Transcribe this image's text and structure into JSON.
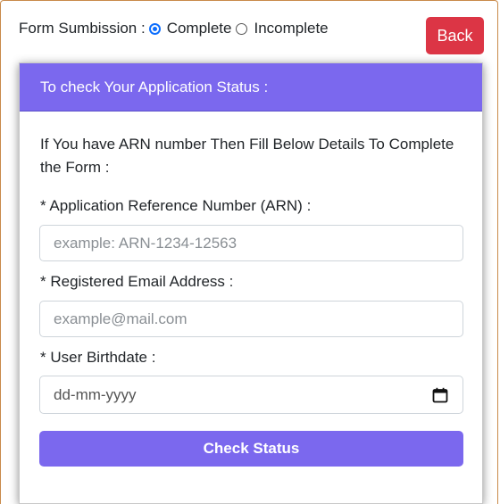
{
  "form_submission": {
    "label": "Form Sumbission :",
    "options": [
      {
        "label": "Complete",
        "checked": true
      },
      {
        "label": "Incomplete",
        "checked": false
      }
    ]
  },
  "back_button": {
    "label": "Back"
  },
  "card": {
    "header": "To check Your Application Status :",
    "intro": "If You have ARN number Then Fill Below Details To Complete the Form :",
    "fields": {
      "arn": {
        "label": "* Application Reference Number (ARN) :",
        "placeholder": "example: ARN-1234-12563"
      },
      "email": {
        "label": "* Registered Email Address :",
        "placeholder": "example@mail.com"
      },
      "birthdate": {
        "label": "* User Birthdate :",
        "placeholder": "dd-mm-yyyy",
        "icon": "calendar-icon"
      }
    },
    "submit_label": "Check Status"
  },
  "colors": {
    "accent": "#7b68ee",
    "danger": "#dc3545",
    "radio_checked": "#0d6efd"
  }
}
